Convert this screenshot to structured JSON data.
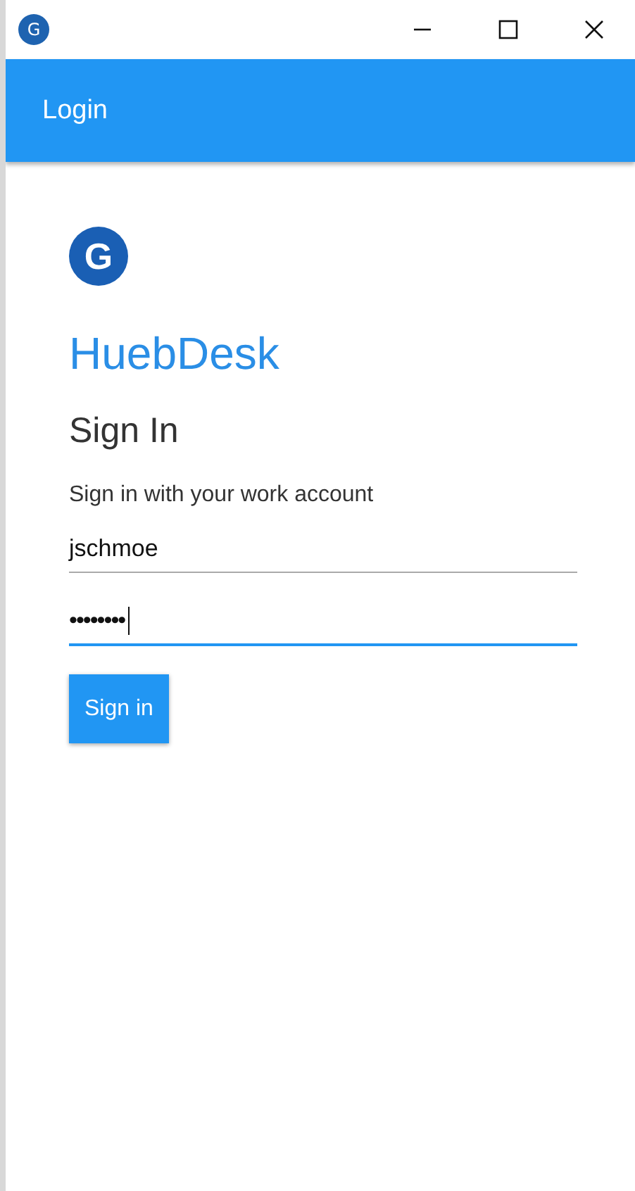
{
  "window": {
    "icon_letter": "G"
  },
  "app_bar": {
    "title": "Login"
  },
  "logo": {
    "letter": "G"
  },
  "brand": "HuebDesk",
  "heading": "Sign In",
  "subtitle": "Sign in with your work account",
  "fields": [
    {
      "kind": "text",
      "value": "jschmoe",
      "focused": false
    },
    {
      "kind": "password",
      "value": "••••••••",
      "focused": true
    }
  ],
  "button": {
    "label": "Sign in"
  }
}
